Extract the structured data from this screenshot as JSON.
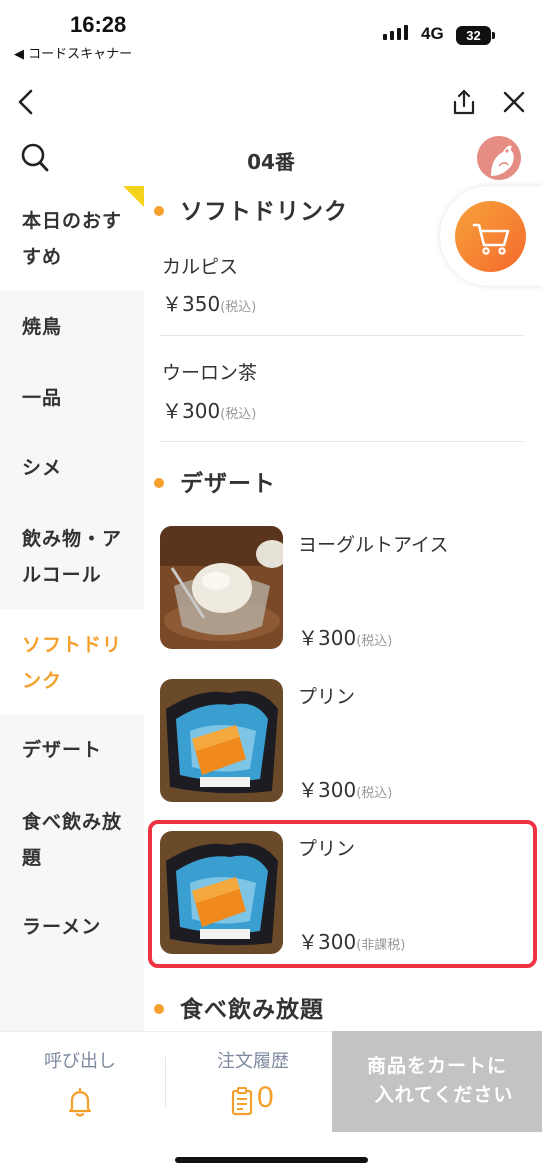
{
  "status_bar": {
    "time": "16:28",
    "back_app": "◀ コードスキャナー",
    "network": "4G",
    "battery": "32"
  },
  "header": {
    "title": "04番"
  },
  "sidebar": {
    "items": [
      {
        "label": "本日のおすすめ"
      },
      {
        "label": "焼鳥"
      },
      {
        "label": "一品"
      },
      {
        "label": "シメ"
      },
      {
        "label": "飲み物・アルコール"
      },
      {
        "label": "ソフトドリンク"
      },
      {
        "label": "デザート"
      },
      {
        "label": "食べ飲み放題"
      },
      {
        "label": "ラーメン"
      }
    ]
  },
  "menu": {
    "sections": [
      {
        "title": "ソフトドリンク",
        "items": [
          {
            "name": "カルピス",
            "price": "￥350",
            "tax": "(税込)"
          },
          {
            "name": "ウーロン茶",
            "price": "￥300",
            "tax": "(税込)"
          }
        ]
      },
      {
        "title": "デザート",
        "items": [
          {
            "name": "ヨーグルトアイス",
            "price": "￥300",
            "tax": "(税込)"
          },
          {
            "name": "プリン",
            "price": "￥300",
            "tax": "(税込)"
          },
          {
            "name": "プリン",
            "price": "￥300",
            "tax": "(非課税)"
          }
        ]
      },
      {
        "title": "食べ飲み放題",
        "items": []
      }
    ]
  },
  "bottom_bar": {
    "call_label": "呼び出し",
    "history_label": "注文履歴",
    "history_count": "0",
    "checkout_label_line1": "商品をカートに",
    "checkout_label_line2": "入れてください"
  },
  "colors": {
    "accent": "#f5a02c",
    "highlight_border": "#ee3442",
    "disabled_button": "#c3c3c3",
    "cart_gradient_start": "#f7a23a",
    "cart_gradient_end": "#f56a2e"
  }
}
